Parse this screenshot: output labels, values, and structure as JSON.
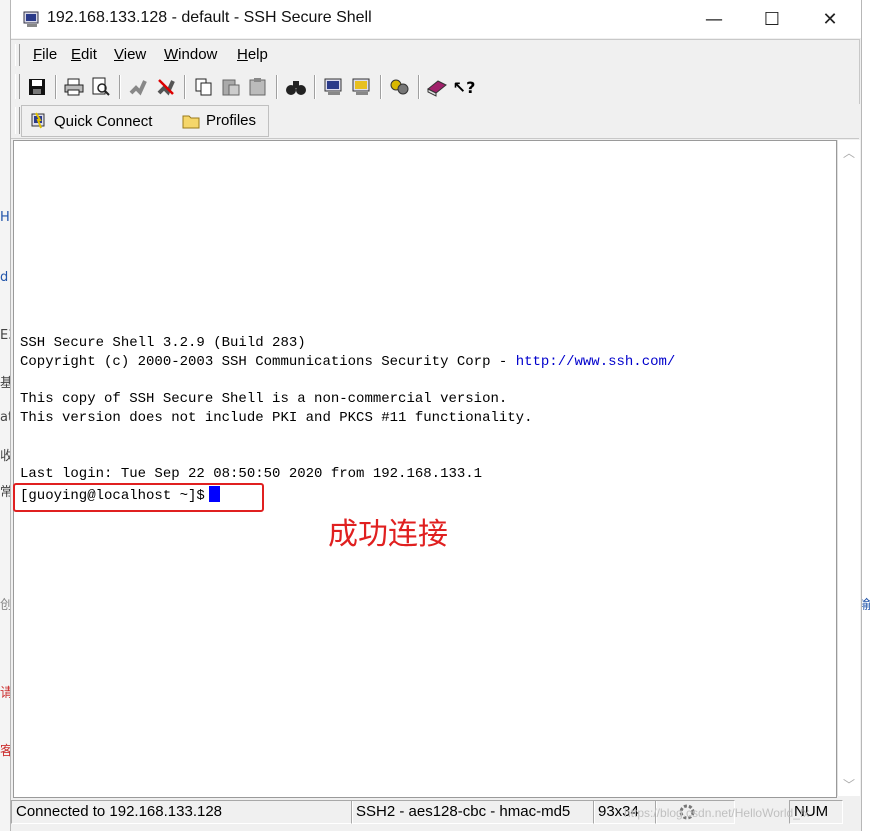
{
  "window": {
    "title": "192.168.133.128 - default - SSH Secure Shell",
    "minimize": "—",
    "maximize": "☐",
    "close": "✕"
  },
  "menu": {
    "items": [
      {
        "underline": "F",
        "rest": "ile"
      },
      {
        "underline": "E",
        "rest": "dit"
      },
      {
        "underline": "V",
        "rest": "iew"
      },
      {
        "underline": "W",
        "rest": "indow"
      },
      {
        "underline": "H",
        "rest": "elp"
      }
    ]
  },
  "toolbar": {
    "icons": [
      "save-icon",
      "print-icon",
      "print-preview-icon",
      "disconnect-icon",
      "connect-icon",
      "copy-icon",
      "paste-icon",
      "paste-alt-icon",
      "find-icon",
      "settings-icon",
      "profile-icon",
      "keys-icon",
      "help-book-icon",
      "context-help-icon"
    ]
  },
  "quick": {
    "connect_label": "Quick Connect",
    "profiles_label": "Profiles"
  },
  "terminal": {
    "line1": "SSH Secure Shell 3.2.9 (Build 283)",
    "line2_prefix": "Copyright (c) 2000-2003 SSH Communications Security Corp - ",
    "line2_link": "http://www.ssh.com/",
    "line3": "This copy of SSH Secure Shell is a non-commercial version.",
    "line4": "This version does not include PKI and PKCS #11 functionality.",
    "line5": "Last login: Tue Sep 22 08:50:50 2020 from 192.168.133.1",
    "prompt": "[guoying@localhost ~]$"
  },
  "annotation": {
    "text": "成功连接",
    "color": "#e02020"
  },
  "status": {
    "connection": "Connected to 192.168.133.128",
    "cipher": "SSH2 - aes128-cbc - hmac-md5",
    "size": "93x34",
    "num": "NUM"
  },
  "watermark": "https://blog.csdn.net/HelloWorld_fx",
  "background_page": {
    "chars": [
      "H",
      "d",
      "E3",
      "基",
      "at",
      "收",
      "常",
      "创",
      "请",
      "客"
    ],
    "right_char": "输"
  }
}
